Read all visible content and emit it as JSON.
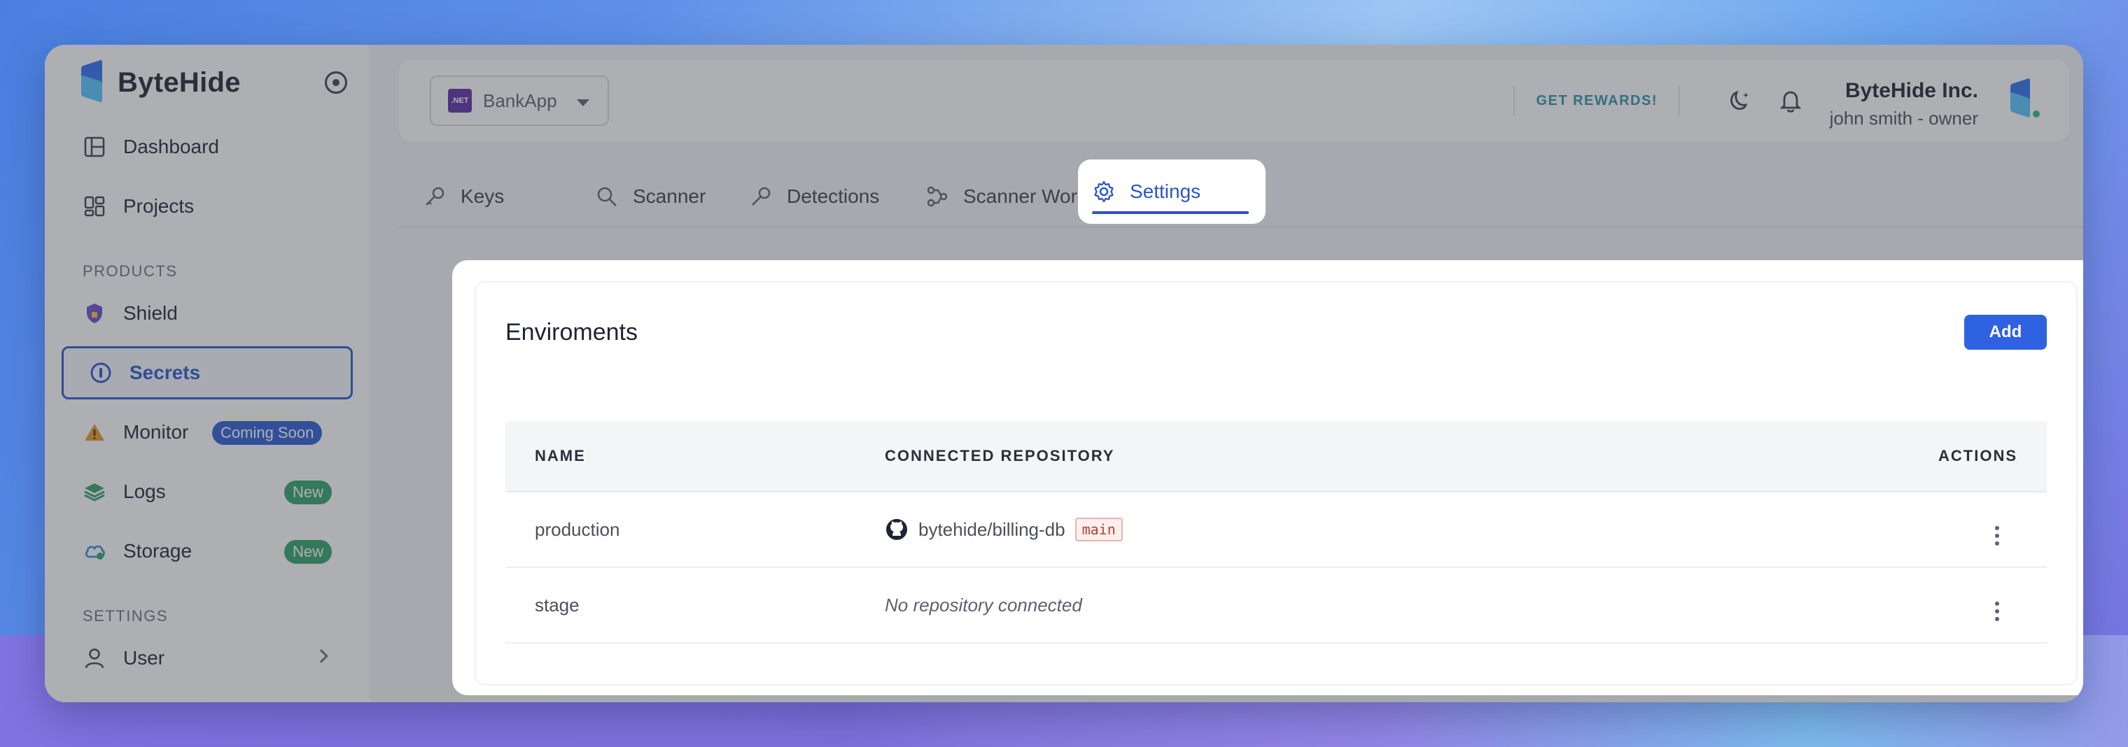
{
  "brand": {
    "name": "ByteHide"
  },
  "sidebar": {
    "items": [
      {
        "label": "Dashboard",
        "icon": "dashboard-icon"
      },
      {
        "label": "Projects",
        "icon": "projects-icon"
      }
    ],
    "products_label": "PRODUCTS",
    "products": [
      {
        "label": "Shield",
        "icon": "shield-icon"
      },
      {
        "label": "Secrets",
        "icon": "secrets-icon",
        "active": true
      },
      {
        "label": "Monitor",
        "icon": "monitor-icon",
        "badge": "Coming Soon"
      },
      {
        "label": "Logs",
        "icon": "logs-icon",
        "badge": "New"
      },
      {
        "label": "Storage",
        "icon": "storage-icon",
        "badge": "New"
      }
    ],
    "settings_label": "SETTINGS",
    "settings": [
      {
        "label": "User",
        "icon": "user-icon"
      }
    ]
  },
  "topbar": {
    "project_chip": ".NET",
    "project": "BankApp",
    "rewards": "GET REWARDS!",
    "org_name": "ByteHide Inc.",
    "user": "john smith - owner"
  },
  "tabs": [
    {
      "label": "Keys",
      "icon": "key-icon"
    },
    {
      "label": "Scanner",
      "icon": "scanner-icon"
    },
    {
      "label": "Detections",
      "icon": "detections-icon"
    },
    {
      "label": "Scanner Workflow",
      "icon": "workflow-icon"
    },
    {
      "label": "Settings",
      "icon": "gear-icon",
      "active": true
    }
  ],
  "environments": {
    "title": "Enviroments",
    "add_label": "Add",
    "columns": [
      "NAME",
      "CONNECTED REPOSITORY",
      "ACTIONS"
    ],
    "rows": [
      {
        "name": "production",
        "repo": "bytehide/billing-db",
        "branch": "main"
      },
      {
        "name": "stage",
        "repo_empty": "No repository connected"
      }
    ]
  },
  "colors": {
    "accent": "#2f62e0",
    "new_badge": "#2fa36b",
    "soon_badge": "#2b5cd6"
  }
}
